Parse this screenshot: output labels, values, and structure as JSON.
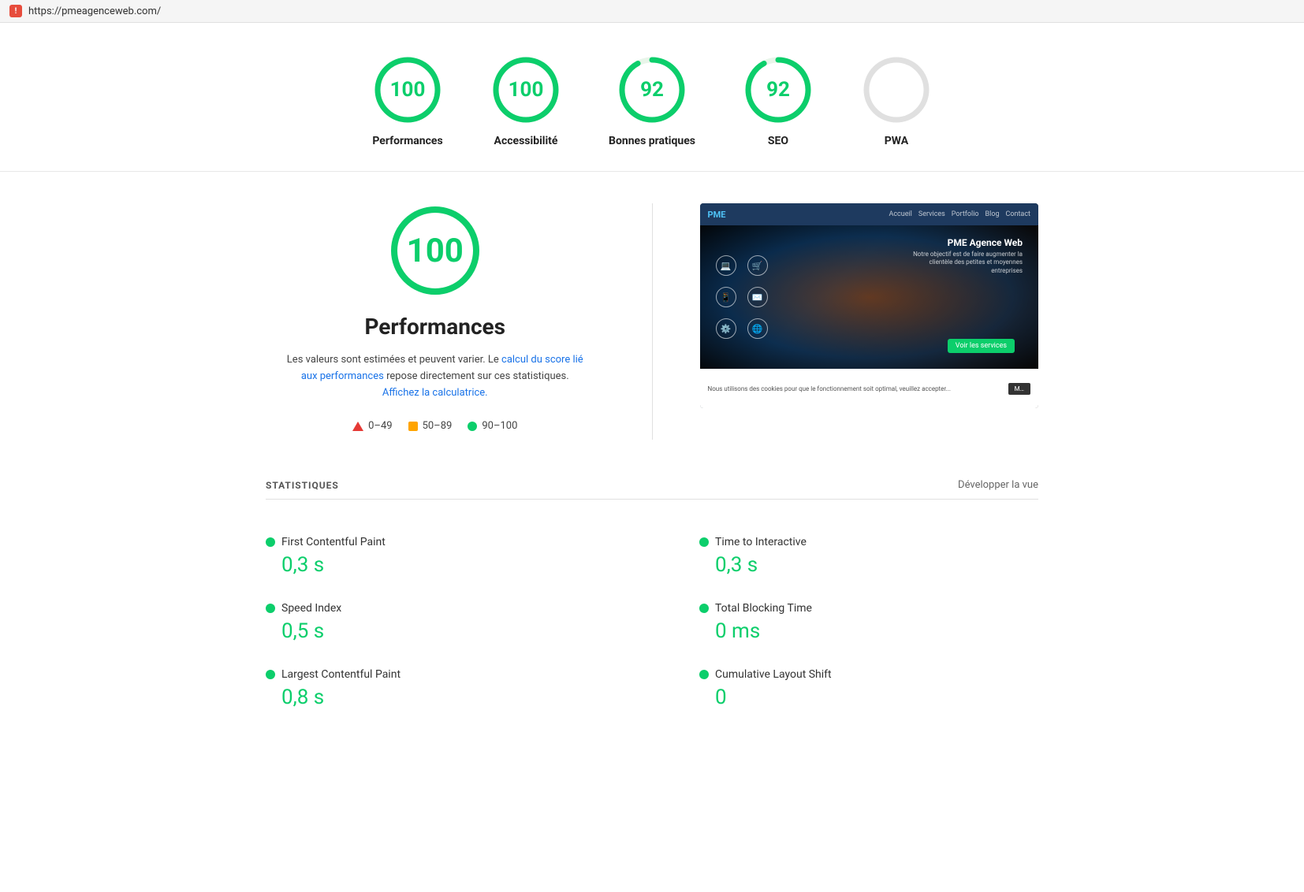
{
  "topbar": {
    "url": "https://pmeagenceweb.com/",
    "icon_label": "!"
  },
  "scores": [
    {
      "id": "performances",
      "value": "100",
      "label": "Performances",
      "color": "#0cce6b",
      "type": "green"
    },
    {
      "id": "accessibilite",
      "value": "100",
      "label": "Accessibilité",
      "color": "#0cce6b",
      "type": "green"
    },
    {
      "id": "bonnes-pratiques",
      "value": "92",
      "label": "Bonnes pratiques",
      "color": "#0cce6b",
      "type": "green"
    },
    {
      "id": "seo",
      "value": "92",
      "label": "SEO",
      "color": "#0cce6b",
      "type": "green"
    },
    {
      "id": "pwa",
      "value": "PWA",
      "label": "PWA",
      "color": "#999",
      "type": "gray"
    }
  ],
  "main": {
    "big_score": "100",
    "title": "Performances",
    "description_part1": "Les valeurs sont estimées et peuvent varier. Le ",
    "link1_text": "calcul du score lié aux performances",
    "link1_href": "#",
    "description_part2": " repose directement sur ces statistiques. ",
    "link2_text": "Affichez la calculatrice.",
    "link2_href": "#"
  },
  "legend": {
    "items": [
      {
        "type": "triangle",
        "range": "0–49",
        "color": "#e53935"
      },
      {
        "type": "square",
        "range": "50–89",
        "color": "#ffa400"
      },
      {
        "type": "dot",
        "range": "90–100",
        "color": "#0cce6b"
      }
    ]
  },
  "screenshot": {
    "site_name": "PME Agence Web",
    "subtitle": "Notre objectif est de faire augmenter la clientèle des petites et moyennes entreprises",
    "btn_label": "Voir les services",
    "cookie_text": "Nous utilisons des cookies pour que le fonctionnement soit optimal, veuillez accepter...",
    "cookie_btn": "M…"
  },
  "stats": {
    "title": "STATISTIQUES",
    "expand_label": "Développer la vue",
    "items": [
      {
        "label": "First Contentful Paint",
        "value": "0,3 s",
        "side": "left"
      },
      {
        "label": "Time to Interactive",
        "value": "0,3 s",
        "side": "right"
      },
      {
        "label": "Speed Index",
        "value": "0,5 s",
        "side": "left"
      },
      {
        "label": "Total Blocking Time",
        "value": "0 ms",
        "side": "right"
      },
      {
        "label": "Largest Contentful Paint",
        "value": "0,8 s",
        "side": "left"
      },
      {
        "label": "Cumulative Layout Shift",
        "value": "0",
        "side": "right"
      }
    ]
  }
}
